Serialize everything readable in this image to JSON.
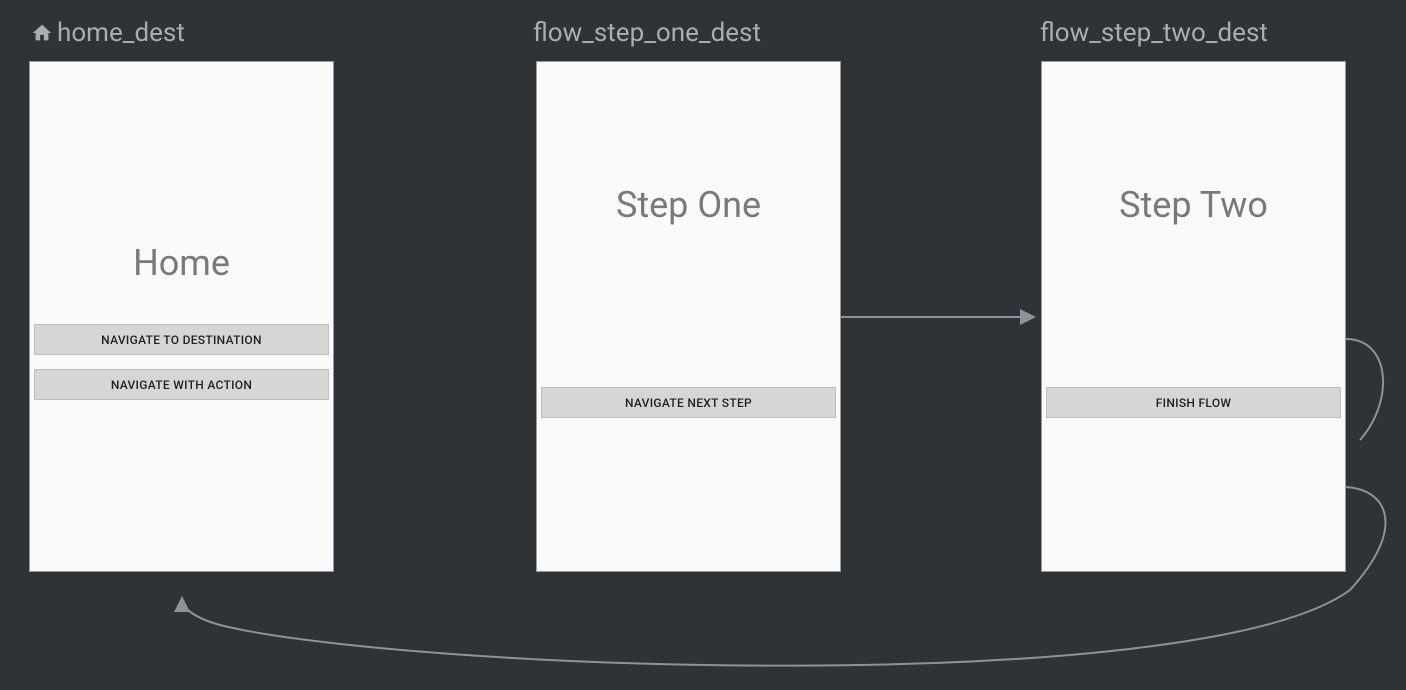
{
  "destinations": {
    "home": {
      "label": "home_dest",
      "title": "Home",
      "buttons": [
        {
          "label": "NAVIGATE TO DESTINATION"
        },
        {
          "label": "NAVIGATE WITH ACTION"
        }
      ]
    },
    "step_one": {
      "label": "flow_step_one_dest",
      "title": "Step One",
      "buttons": [
        {
          "label": "NAVIGATE NEXT STEP"
        }
      ]
    },
    "step_two": {
      "label": "flow_step_two_dest",
      "title": "Step Two",
      "buttons": [
        {
          "label": "FINISH FLOW"
        }
      ]
    }
  }
}
